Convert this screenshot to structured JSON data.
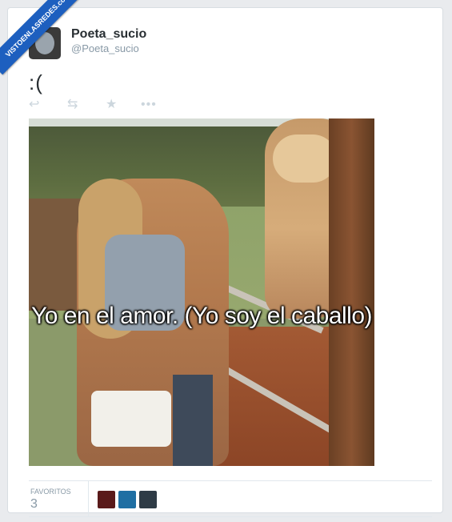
{
  "ribbon": {
    "text": "VISTOENLASREDES.com"
  },
  "tweet": {
    "display_name": "Poeta_sucio",
    "handle": "@Poeta_sucio",
    "text": ":("
  },
  "actions": {
    "reply_icon": "reply-icon",
    "retweet_icon": "retweet-icon",
    "favorite_icon": "star-icon",
    "more_icon": "more-icon"
  },
  "photo": {
    "caption": "Yo en el amor. (Yo soy el caballo)"
  },
  "stats": {
    "favorites_label": "FAVORITOS",
    "favorites_count": "3"
  },
  "colors": {
    "background": "#e9ebee",
    "name_text": "#292f33",
    "muted_text": "#8899a6",
    "action_icons": "#ccd6dd",
    "ribbon": "#1d5fbf"
  }
}
